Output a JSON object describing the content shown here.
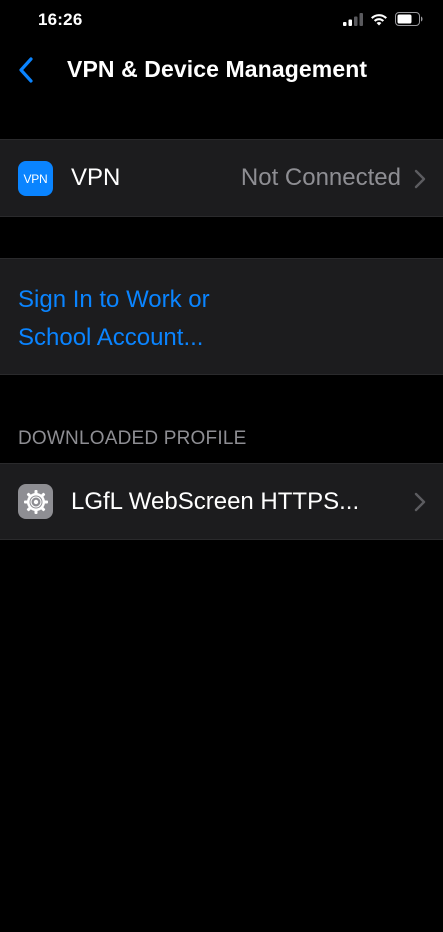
{
  "status_bar": {
    "time": "16:26",
    "icons": [
      "cellular-signal-icon",
      "wifi-icon",
      "battery-icon"
    ]
  },
  "nav": {
    "back_icon": "chevron-left-icon",
    "title": "VPN & Device Management"
  },
  "vpn_row": {
    "icon_text": "VPN",
    "label": "VPN",
    "value": "Not Connected",
    "icon_color": "#0a84ff"
  },
  "sign_in": {
    "line1": "Sign In to Work or",
    "line2": "School Account..."
  },
  "downloaded_profile": {
    "header": "DOWNLOADED PROFILE",
    "items": [
      {
        "label": "LGfL WebScreen HTTPS...",
        "icon": "gear-icon"
      }
    ]
  },
  "colors": {
    "background": "#000000",
    "cell_background": "#1c1c1e",
    "accent": "#0a84ff",
    "secondary_text": "#8e8e93"
  }
}
